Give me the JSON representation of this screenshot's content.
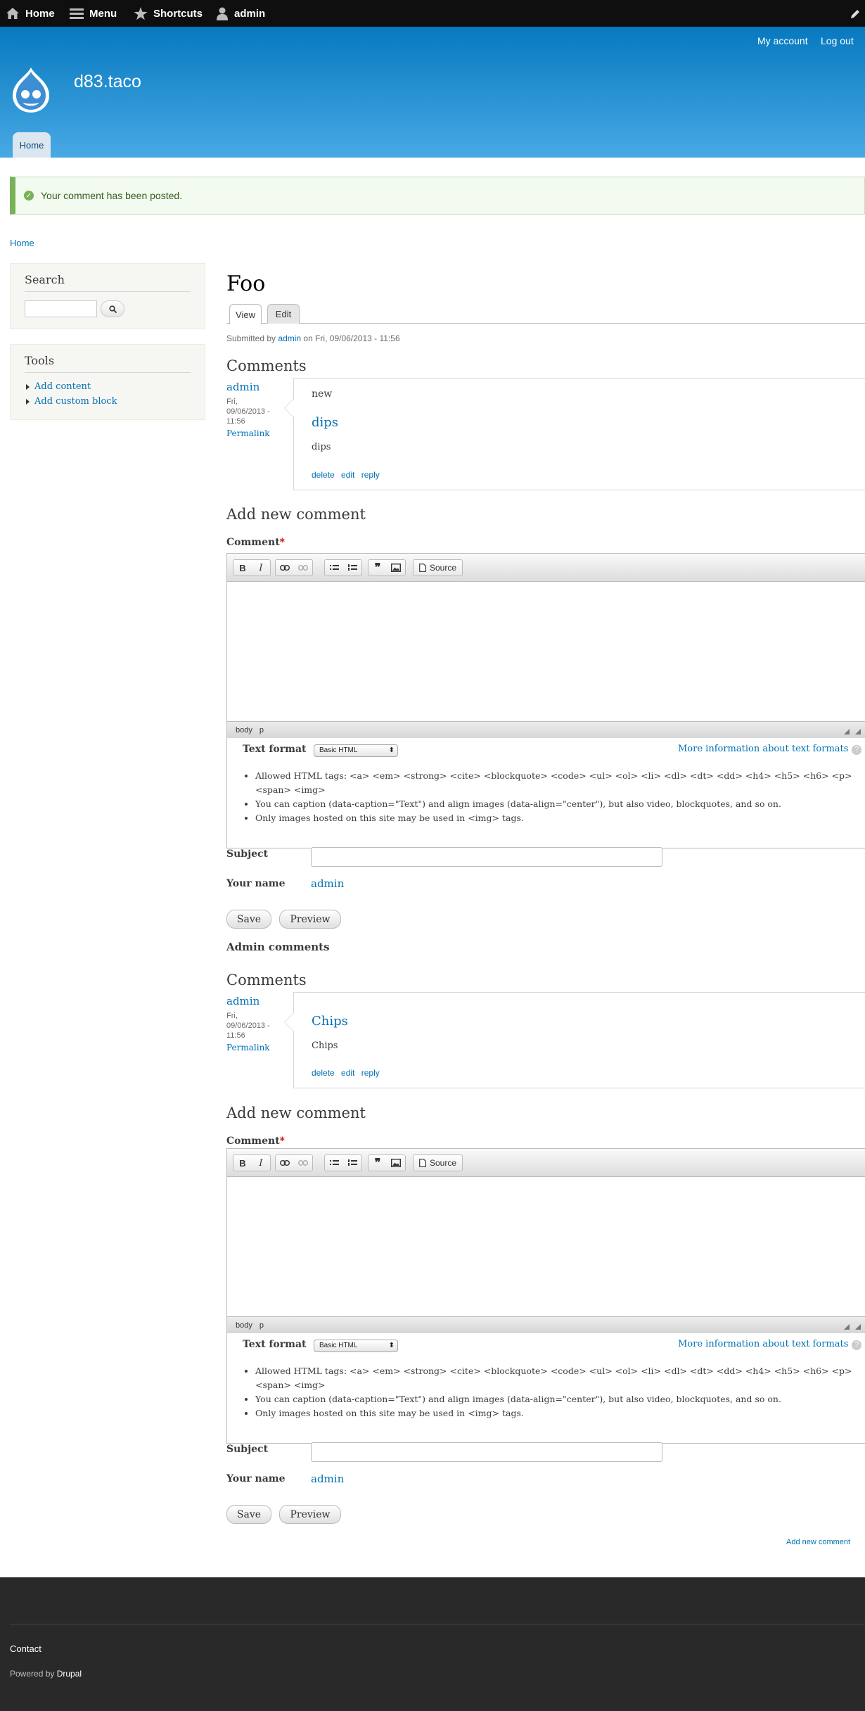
{
  "toolbar": {
    "home": "Home",
    "menu": "Menu",
    "shortcuts": "Shortcuts",
    "user": "admin"
  },
  "header": {
    "my_account": "My account",
    "log_out": "Log out",
    "site_name": "d83.taco",
    "home_tab": "Home"
  },
  "message": "Your comment has been posted.",
  "breadcrumb": "Home",
  "sidebar": {
    "search_title": "Search",
    "tools_title": "Tools",
    "tools": [
      "Add content",
      "Add custom block"
    ]
  },
  "node": {
    "title": "Foo",
    "tabs": [
      "View",
      "Edit"
    ],
    "submitted_prefix": "Submitted by",
    "submitted_author": "admin",
    "submitted_suffix": "on Fri, 09/06/2013 - 11:56"
  },
  "comments_1": {
    "heading": "Comments",
    "author": "admin",
    "date": "Fri, 09/06/2013 - 11:56",
    "permalink": "Permalink",
    "new_mark": "new",
    "title": "dips",
    "body": "dips",
    "links": [
      "delete",
      "edit",
      "reply"
    ]
  },
  "form": {
    "heading": "Add new comment",
    "comment_label": "Comment",
    "required": "*",
    "source": "Source",
    "path": [
      "body",
      "p"
    ],
    "text_format_label": "Text format",
    "text_format_value": "Basic HTML",
    "more_info": "More information about text formats",
    "tips": [
      "Allowed HTML tags: <a> <em> <strong> <cite> <blockquote> <code> <ul> <ol> <li> <dl> <dt> <dd> <h4> <h5> <h6> <p> <span> <img>",
      "You can caption (data-caption=\"Text\") and align images (data-align=\"center\"), but also video, blockquotes, and so on.",
      "Only images hosted on this site may be used in <img> tags."
    ],
    "subject_label": "Subject",
    "name_label": "Your name",
    "name_value": "admin",
    "save": "Save",
    "preview": "Preview"
  },
  "admin_comments": "Admin comments",
  "comments_2": {
    "heading": "Comments",
    "author": "admin",
    "date": "Fri, 09/06/2013 - 11:56",
    "permalink": "Permalink",
    "title": "Chips",
    "body": "Chips",
    "links": [
      "delete",
      "edit",
      "reply"
    ]
  },
  "add_new_comment_link": "Add new comment",
  "footer": {
    "contact": "Contact",
    "powered_prefix": "Powered by",
    "powered_link": "Drupal"
  }
}
